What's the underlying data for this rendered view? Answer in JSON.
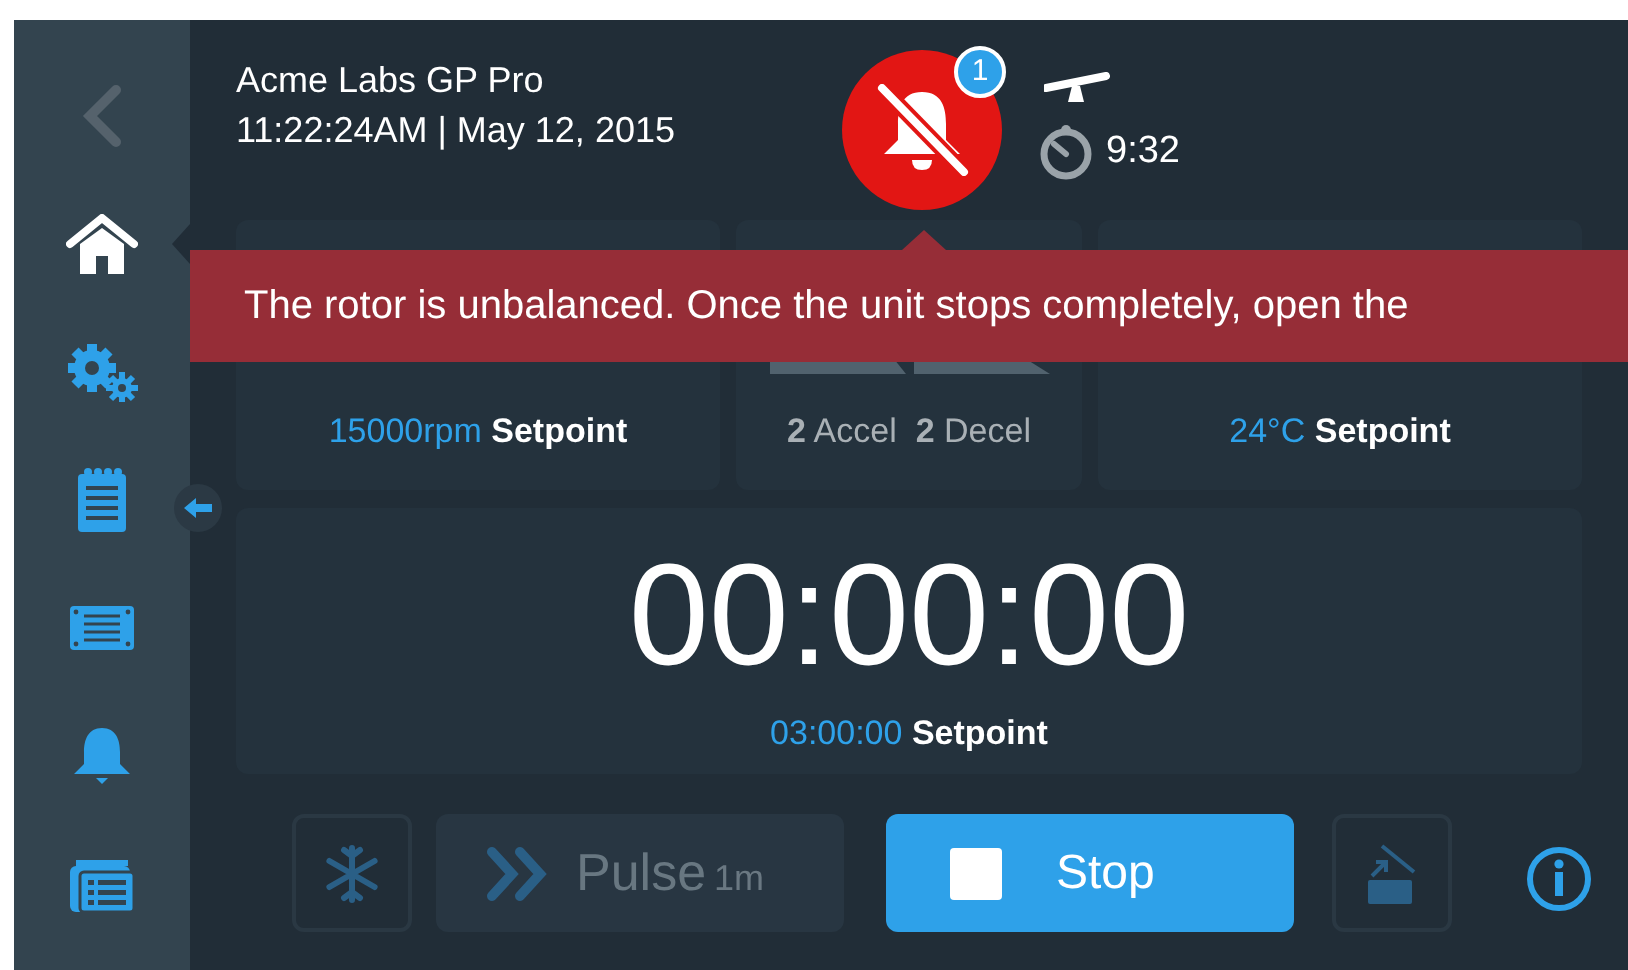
{
  "sidebar": {
    "items": [
      {
        "kind": "back",
        "selected": false
      },
      {
        "kind": "home",
        "selected": true
      },
      {
        "kind": "settings",
        "selected": false
      },
      {
        "kind": "protocols",
        "selected": false
      },
      {
        "kind": "rotor",
        "selected": false
      },
      {
        "kind": "alarms",
        "selected": false
      },
      {
        "kind": "log",
        "selected": false
      }
    ]
  },
  "header": {
    "title": "Acme Labs GP Pro",
    "datetime": "11:22:24AM | May 12, 2015"
  },
  "alarm": {
    "count": "1",
    "muted": true
  },
  "status": {
    "run_time": "9:32"
  },
  "banner": {
    "message": "The rotor is unbalanced. Once the unit stops completely, open the"
  },
  "speed": {
    "setpoint": "15000rpm",
    "setpoint_label": "Setpoint"
  },
  "rates": {
    "accel_value": "2",
    "accel_label": "Accel",
    "decel_value": "2",
    "decel_label": "Decel"
  },
  "temperature": {
    "setpoint": "24°C",
    "setpoint_label": "Setpoint"
  },
  "timer": {
    "value": "00:00:00",
    "setpoint": "03:00:00",
    "setpoint_label": "Setpoint"
  },
  "buttons": [
    {
      "kind": "cool",
      "disabled": true
    },
    {
      "kind": "pulse",
      "label": "Pulse",
      "duration": "1m",
      "disabled": true
    },
    {
      "kind": "stop",
      "label": "Stop",
      "disabled": false
    },
    {
      "kind": "lid",
      "disabled": true
    }
  ]
}
